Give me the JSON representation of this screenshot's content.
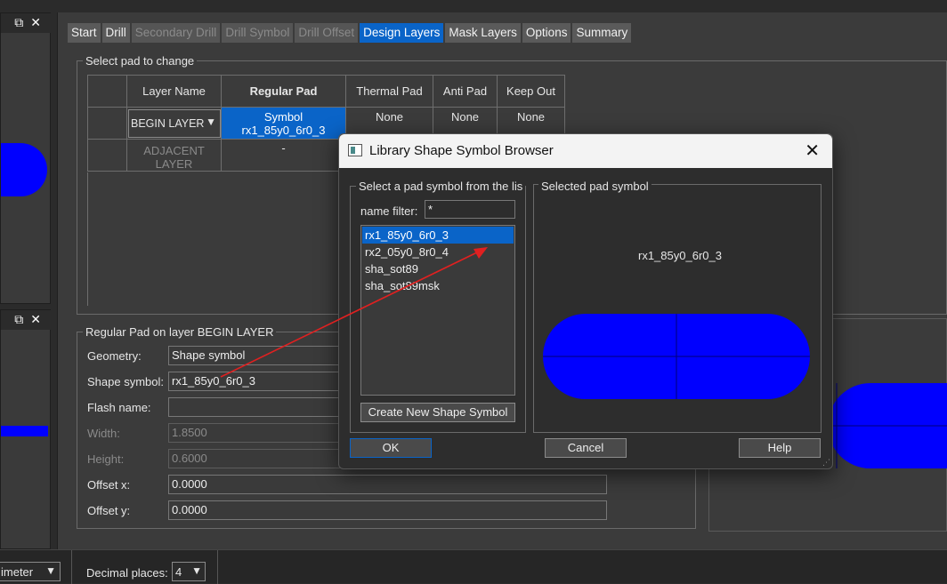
{
  "tabs": [
    {
      "label": "Start",
      "state": "normal"
    },
    {
      "label": "Drill",
      "state": "normal"
    },
    {
      "label": "Secondary Drill",
      "state": "disabled"
    },
    {
      "label": "Drill Symbol",
      "state": "disabled"
    },
    {
      "label": "Drill Offset",
      "state": "disabled"
    },
    {
      "label": "Design Layers",
      "state": "active"
    },
    {
      "label": "Mask Layers",
      "state": "normal"
    },
    {
      "label": "Options",
      "state": "normal"
    },
    {
      "label": "Summary",
      "state": "normal"
    }
  ],
  "select_pad": {
    "legend": "Select pad to change",
    "headers": [
      "Layer Name",
      "Regular Pad",
      "Thermal Pad",
      "Anti Pad",
      "Keep Out"
    ],
    "rows": [
      {
        "layer": "BEGIN LAYER",
        "regular": "Symbol rx1_85y0_6r0_3",
        "thermal": "None",
        "anti": "None",
        "keepout": "None"
      },
      {
        "layer": "ADJACENT LAYER",
        "regular": "-",
        "thermal": "",
        "anti": "",
        "keepout": ""
      }
    ]
  },
  "regular_pad": {
    "legend": "Regular Pad on layer BEGIN LAYER",
    "geometry_label": "Geometry:",
    "geometry_value": "Shape symbol",
    "shape_label": "Shape symbol:",
    "shape_value": "rx1_85y0_6r0_3",
    "flash_label": "Flash name:",
    "flash_value": "",
    "width_label": "Width:",
    "width_value": "1.8500",
    "height_label": "Height:",
    "height_value": "0.6000",
    "offx_label": "Offset x:",
    "offx_value": "0.0000",
    "offy_label": "Offset y:",
    "offy_value": "0.0000"
  },
  "dialog": {
    "title": "Library Shape Symbol Browser",
    "list_legend": "Select a pad symbol from the lis",
    "filter_label": "name filter:",
    "filter_value": "*",
    "symbols": [
      "rx1_85y0_6r0_3",
      "rx2_05y0_8r0_4",
      "sha_sot89",
      "sha_sot89msk"
    ],
    "selected_index": 0,
    "create_button": "Create New Shape  Symbol",
    "preview_legend": "Selected pad symbol",
    "preview_name": "rx1_85y0_6r0_3",
    "ok": "OK",
    "cancel": "Cancel",
    "help": "Help"
  },
  "status": {
    "units_value": "imeter",
    "decimal_label": "Decimal places:",
    "decimal_value": "4"
  },
  "colors": {
    "pad_fill": "#0000ff",
    "accent": "#0a64c8",
    "arrow": "#e02020"
  }
}
